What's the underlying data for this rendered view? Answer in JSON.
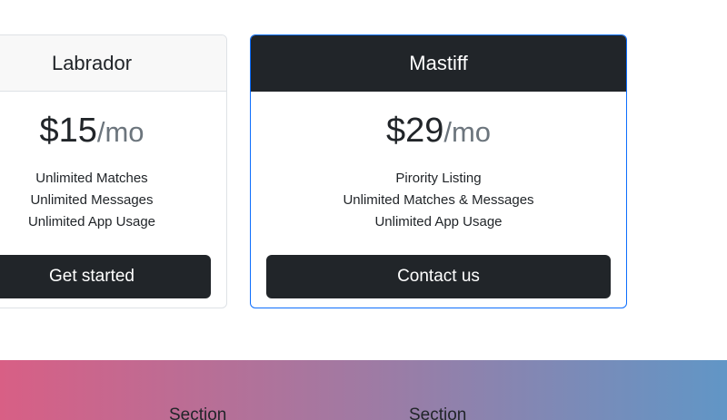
{
  "plans": [
    {
      "name": "Labrador",
      "price": "$15",
      "period": "/mo",
      "features": [
        "Unlimited Matches",
        "Unlimited Messages",
        "Unlimited App Usage"
      ],
      "cta": "Get started"
    },
    {
      "name": "Mastiff",
      "price": "$29",
      "period": "/mo",
      "features": [
        "Pirority Listing",
        "Unlimited Matches & Messages",
        "Unlimited App Usage"
      ],
      "cta": "Contact us"
    }
  ],
  "footer": {
    "columns": [
      {
        "heading": "Section"
      },
      {
        "heading": "Section"
      }
    ]
  },
  "colors": {
    "dark": "#212529",
    "accent_border": "#0d6efd",
    "gradient_start": "#d85f85",
    "gradient_end": "#6196c6"
  }
}
